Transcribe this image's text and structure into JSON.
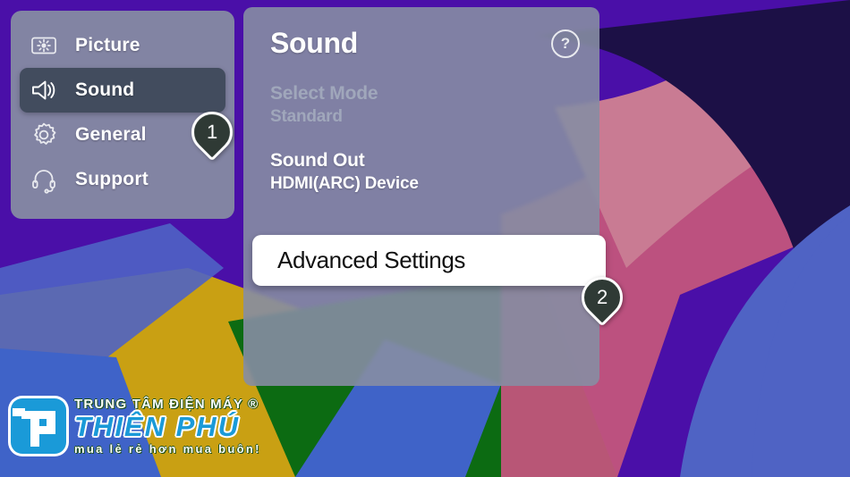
{
  "background": {
    "base_color": "#4a0fa8",
    "shape_colors": {
      "deep_purple": "#3d0b9e",
      "navy": "#1c1046",
      "periwinkle": "#4f63c4",
      "rose": "#c2557c",
      "dusty_pink": "#c97b93",
      "gold": "#c9a013",
      "green": "#0c6b12",
      "blue": "#3f63c8"
    }
  },
  "sidebar": {
    "items": [
      {
        "label": "Picture",
        "icon": "picture-icon",
        "active": false
      },
      {
        "label": "Sound",
        "icon": "speaker-icon",
        "active": true
      },
      {
        "label": "General",
        "icon": "gear-icon",
        "active": false
      },
      {
        "label": "Support",
        "icon": "headset-icon",
        "active": false
      }
    ]
  },
  "sound_panel": {
    "title": "Sound",
    "help_icon_label": "?",
    "options": [
      {
        "title": "Select Mode",
        "value": "Standard",
        "state": "dim"
      },
      {
        "title": "Sound Out",
        "value": "HDMI(ARC) Device",
        "state": "lit"
      }
    ]
  },
  "advanced_row": {
    "label": "Advanced Settings",
    "highlight_color": "#ffffff",
    "text_color": "#111111"
  },
  "step_pins": [
    {
      "number": "1",
      "target": "sidebar-item-sound"
    },
    {
      "number": "2",
      "target": "advanced-settings-row"
    }
  ],
  "watermark": {
    "top_line": "TRUNG TÂM ĐIỆN MÁY ®",
    "brand": "THIÊN PHÚ",
    "tagline": "mua lẻ rẻ hơn mua buôn!",
    "mark_letters": "TP",
    "mark_color": "#1a9ad8"
  }
}
